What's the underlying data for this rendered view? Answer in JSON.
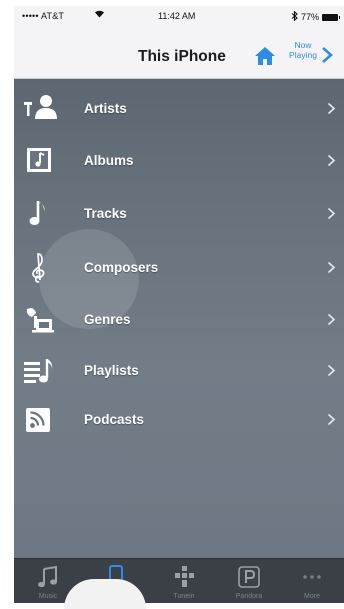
{
  "status_bar": {
    "carrier": "••••• AT&T",
    "time": "11:42 AM",
    "battery": "77%"
  },
  "nav": {
    "title": "This iPhone",
    "now_playing": "Now Playing",
    "home_icon": "home-icon",
    "accent_color": "#2d8ce6"
  },
  "menu": {
    "items": [
      {
        "label": "Artists",
        "icon": "artist-icon"
      },
      {
        "label": "Albums",
        "icon": "album-icon"
      },
      {
        "label": "Tracks",
        "icon": "music-note-icon"
      },
      {
        "label": "Composers",
        "icon": "treble-clef-icon"
      },
      {
        "label": "Genres",
        "icon": "genre-icon"
      },
      {
        "label": "Playlists",
        "icon": "playlist-icon"
      },
      {
        "label": "Podcasts",
        "icon": "podcast-icon"
      }
    ]
  },
  "tab_bar": {
    "tabs": [
      {
        "label": "Music",
        "icon": "music-note-icon"
      },
      {
        "label": "",
        "icon": "phone-icon"
      },
      {
        "label": "Tunein",
        "icon": "tunein-icon"
      },
      {
        "label": "Pandora",
        "icon": "pandora-icon"
      },
      {
        "label": "More",
        "icon": "more-icon"
      }
    ]
  }
}
